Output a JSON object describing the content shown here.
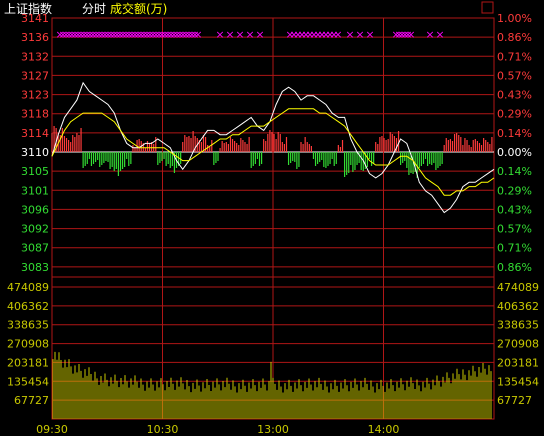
{
  "header": {
    "index_name": "上证指数",
    "mode": "分时",
    "volume_label": "成交额(万)"
  },
  "colors": {
    "background": "#000000",
    "grid_red": "#b01616",
    "up_red": "#ff3b3b",
    "down_green": "#33dd33",
    "price_white": "#ffffff",
    "avg_yellow": "#ffff00",
    "volume_yellow": "#c8c800",
    "limit_magenta": "#ff00ff"
  },
  "chart_data": [
    {
      "type": "line",
      "name": "price",
      "y_ticks_up": [
        "3141",
        "3136",
        "3132",
        "3127",
        "3123",
        "3118",
        "3114"
      ],
      "y_tick_base": "3110",
      "y_ticks_down": [
        "3105",
        "3101",
        "3096",
        "3092",
        "3087",
        "3083"
      ],
      "pct_ticks_up": [
        "1.00%",
        "0.86%",
        "0.71%",
        "0.57%",
        "0.43%",
        "0.29%",
        "0.14%"
      ],
      "pct_tick_base": "0.00%",
      "pct_ticks_down": [
        "0.14%",
        "0.29%",
        "0.43%",
        "0.57%",
        "0.71%",
        "0.86%"
      ],
      "ylim": [
        3079,
        3141
      ],
      "base": 3110,
      "x_ticks": [
        "09:30",
        "10:30",
        "13:00",
        "14:00"
      ],
      "series": [
        {
          "values": [
            3109,
            3114,
            3118,
            3120,
            3122,
            3126,
            3124,
            3123,
            3122,
            3121,
            3119,
            3115,
            3112,
            3111,
            3111,
            3112,
            3112,
            3113,
            3112,
            3111,
            3108,
            3106,
            3108,
            3111,
            3113,
            3115,
            3115,
            3114,
            3114,
            3115,
            3116,
            3117,
            3118,
            3116,
            3115,
            3117,
            3121,
            3124,
            3125,
            3124,
            3122,
            3123,
            3123,
            3122,
            3121,
            3119,
            3118,
            3118,
            3113,
            3110,
            3108,
            3105,
            3104,
            3105,
            3107,
            3110,
            3113,
            3112,
            3108,
            3103,
            3101,
            3100,
            3098,
            3096,
            3097,
            3099,
            3102,
            3103,
            3103,
            3104,
            3105,
            3106
          ]
        },
        {
          "values": [
            3109,
            3112,
            3115,
            3117,
            3118,
            3119,
            3119,
            3119,
            3119,
            3118,
            3117,
            3115,
            3113,
            3112,
            3111,
            3111,
            3111,
            3111,
            3111,
            3110,
            3109,
            3108,
            3108,
            3109,
            3110,
            3111,
            3112,
            3113,
            3113,
            3114,
            3114,
            3115,
            3116,
            3116,
            3116,
            3117,
            3118,
            3119,
            3120,
            3120,
            3120,
            3120,
            3120,
            3119,
            3119,
            3118,
            3117,
            3116,
            3114,
            3112,
            3110,
            3108,
            3107,
            3107,
            3107,
            3108,
            3109,
            3109,
            3108,
            3106,
            3104,
            3103,
            3102,
            3100,
            3100,
            3101,
            3101,
            3102,
            3102,
            3103,
            3103,
            3104
          ]
        }
      ]
    },
    {
      "type": "bar",
      "name": "volume",
      "y_ticks": [
        "474089",
        "406362",
        "338635",
        "270908",
        "203181",
        "135454",
        "67727"
      ],
      "ylim": [
        0,
        474089
      ]
    }
  ]
}
